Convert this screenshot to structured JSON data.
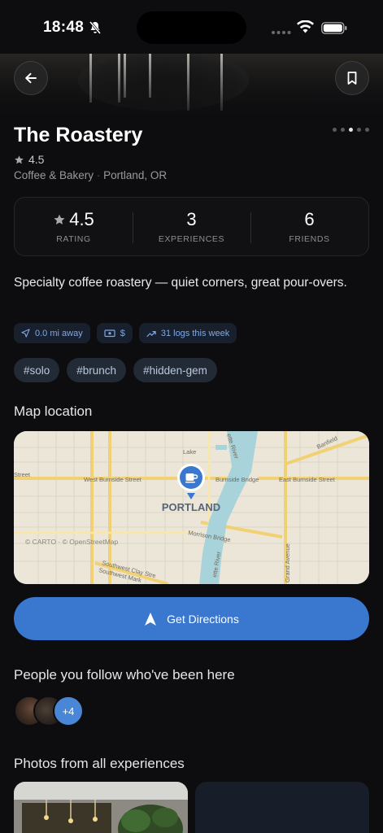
{
  "status_bar": {
    "time": "18:48"
  },
  "place": {
    "name": "The Roastery",
    "rating": "4.5",
    "category": "Coffee & Bakery",
    "location": "Portland, OR",
    "description": "Specialty coffee roastery — quiet corners, great pour-overs."
  },
  "stats": [
    {
      "value": "4.5",
      "label": "RATING"
    },
    {
      "value": "3",
      "label": "EXPERIENCES"
    },
    {
      "value": "6",
      "label": "FRIENDS"
    }
  ],
  "chips": [
    {
      "icon": "navigation-icon",
      "label": "0.0 mi away"
    },
    {
      "icon": "cash-icon",
      "label": "$"
    },
    {
      "icon": "trending-up-icon",
      "label": "31 logs this week"
    }
  ],
  "tags": [
    "#solo",
    "#brunch",
    "#hidden-gem"
  ],
  "sections": {
    "map_title": "Map location",
    "people_title": "People you follow who've been here",
    "photos_title": "Photos from all experiences"
  },
  "map": {
    "city": "PORTLAND",
    "attribution": "© CARTO · © OpenStreetMap",
    "streets": {
      "w_burnside": "West Burnside Street",
      "burnside_bridge": "Burnside Bridge",
      "e_burnside": "East Burnside Street",
      "morrison": "Morrison Bridge",
      "sw_clay": "Southwest Clay Stre",
      "sw_market": "Southwest Mark",
      "street": "Street",
      "grand": "Grand Avenue",
      "banfield": "Banfield",
      "lake": "Lake",
      "river1": "ette River",
      "river2": "ette River"
    }
  },
  "directions_label": "Get Directions",
  "followers_more": "+4",
  "colors": {
    "accent": "#3a78cf",
    "background": "#0d0d0f",
    "chip_text": "#7fa8e6"
  }
}
